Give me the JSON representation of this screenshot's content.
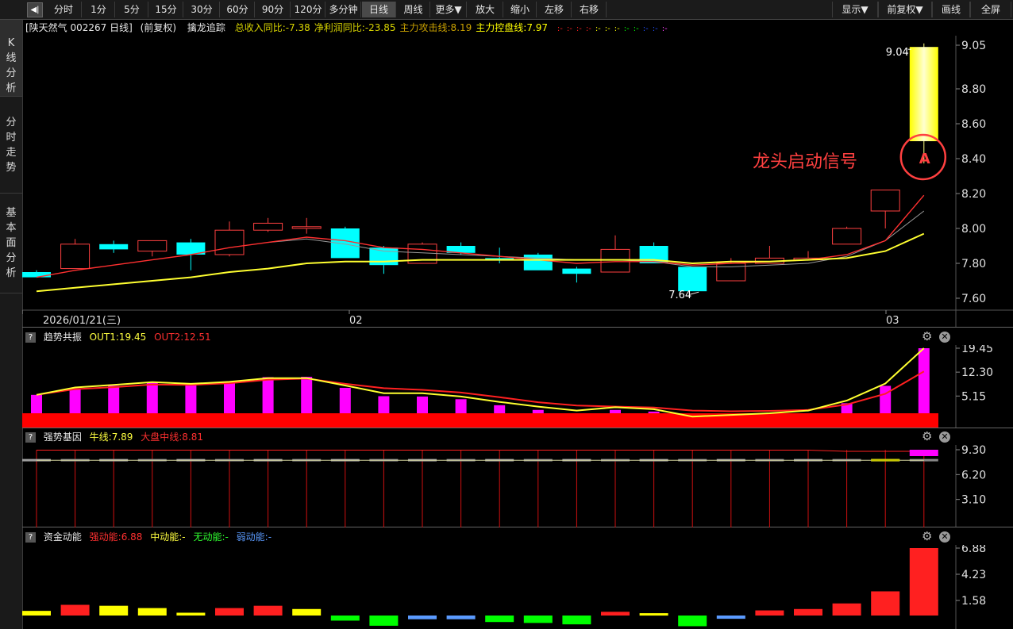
{
  "toolbar": {
    "items": [
      "分时",
      "1分",
      "5分",
      "15分",
      "30分",
      "60分",
      "90分",
      "120分",
      "多分钟",
      "日线",
      "周线",
      "更多▼",
      "放大",
      "缩小",
      "左移",
      "右移"
    ],
    "right": [
      "显示▼",
      "前复权▼",
      "画线",
      "全屏"
    ],
    "back_glyph": "◀|"
  },
  "leftnav": [
    "K线分析",
    "分时走势",
    "基本面分析"
  ],
  "main": {
    "stock": "[陕天然气 002267 日线]",
    "adjust": "(前复权)",
    "indicator": "擒龙追踪",
    "stats": [
      {
        "text": "总收入同比:-7.38",
        "color": "#d8d400"
      },
      {
        "text": "净利润同比:-23.85",
        "color": "#d8d400"
      },
      {
        "text": "主力攻击线:8.19",
        "color": "#c8a000"
      },
      {
        "text": "主力控盘线:7.97",
        "color": "#ffff00"
      }
    ],
    "dots": [
      "#ff2020",
      "#ff2020",
      "#ff2020",
      "#ff2020",
      "#ffff00",
      "#ffff00",
      "#ffff00",
      "#00ff00",
      "#00ff00",
      "#2050ff",
      "#2050ff",
      "#ff40ff"
    ],
    "dot_glyph": ":-",
    "price_ticks": [
      "9.05",
      "8.80",
      "8.60",
      "8.40",
      "8.20",
      "8.00",
      "7.80",
      "7.60"
    ],
    "date_labels": [
      "2026/01/21(三)",
      "02",
      "03"
    ],
    "max_label": "9.04",
    "min_label": "7.64",
    "signal_text": "龙头启动信号",
    "signal_glyph": "A"
  },
  "panel_trend": {
    "name": "趋势共振",
    "out1": "OUT1:19.45",
    "out2": "OUT2:12.51",
    "ticks": [
      "19.45",
      "12.30",
      "5.15"
    ]
  },
  "panel_gene": {
    "name": "强势基因",
    "bull": "牛线:7.89",
    "mid": "大盘中线:8.81",
    "ticks": [
      "9.30",
      "6.20",
      "3.10"
    ]
  },
  "panel_fund": {
    "name": "资金动能",
    "strong": "强动能:6.88",
    "medium": "中动能:-",
    "none": "无动能:-",
    "weak": "弱动能:-",
    "ticks": [
      "6.88",
      "4.23",
      "1.58"
    ]
  },
  "colors": {
    "up": "#ff4040",
    "down": "#00ffff",
    "ma_fast": "#ff3030",
    "ma_slow": "#ffff30",
    "ma_gray": "#9a9a9a",
    "magenta": "#ff00ff",
    "signal": "#ff4040"
  },
  "chart_data": {
    "type": "candlestick",
    "candles": [
      {
        "o": 7.75,
        "c": 7.72,
        "h": 7.76,
        "l": 7.72
      },
      {
        "o": 7.77,
        "c": 7.91,
        "h": 7.94,
        "l": 7.77
      },
      {
        "o": 7.91,
        "c": 7.88,
        "h": 7.93,
        "l": 7.86
      },
      {
        "o": 7.87,
        "c": 7.93,
        "h": 7.93,
        "l": 7.84
      },
      {
        "o": 7.92,
        "c": 7.85,
        "h": 7.94,
        "l": 7.76
      },
      {
        "o": 7.85,
        "c": 7.99,
        "h": 8.04,
        "l": 7.84
      },
      {
        "o": 7.99,
        "c": 8.03,
        "h": 8.06,
        "l": 7.98
      },
      {
        "o": 8.0,
        "c": 8.01,
        "h": 8.06,
        "l": 7.97
      },
      {
        "o": 8.0,
        "c": 7.83,
        "h": 8.01,
        "l": 7.83
      },
      {
        "o": 7.89,
        "c": 7.79,
        "h": 7.9,
        "l": 7.74
      },
      {
        "o": 7.8,
        "c": 7.91,
        "h": 7.92,
        "l": 7.8
      },
      {
        "o": 7.9,
        "c": 7.86,
        "h": 7.92,
        "l": 7.85
      },
      {
        "o": 7.83,
        "c": 7.82,
        "h": 7.89,
        "l": 7.8
      },
      {
        "o": 7.85,
        "c": 7.76,
        "h": 7.86,
        "l": 7.76
      },
      {
        "o": 7.77,
        "c": 7.74,
        "h": 7.78,
        "l": 7.69
      },
      {
        "o": 7.75,
        "c": 7.88,
        "h": 7.96,
        "l": 7.75
      },
      {
        "o": 7.9,
        "c": 7.8,
        "h": 7.92,
        "l": 7.8
      },
      {
        "o": 7.78,
        "c": 7.64,
        "h": 7.78,
        "l": 7.64
      },
      {
        "o": 7.7,
        "c": 7.8,
        "h": 7.83,
        "l": 7.7
      },
      {
        "o": 7.8,
        "c": 7.83,
        "h": 7.9,
        "l": 7.8
      },
      {
        "o": 7.82,
        "c": 7.83,
        "h": 7.87,
        "l": 7.82
      },
      {
        "o": 7.91,
        "c": 8.0,
        "h": 8.01,
        "l": 7.91
      },
      {
        "o": 8.1,
        "c": 8.22,
        "h": 8.22,
        "l": 8.0
      },
      {
        "o": 8.5,
        "c": 9.04,
        "h": 9.06,
        "l": 8.5
      }
    ],
    "ma_fast": [
      7.72,
      7.76,
      7.79,
      7.82,
      7.85,
      7.89,
      7.92,
      7.95,
      7.93,
      7.89,
      7.88,
      7.86,
      7.84,
      7.82,
      7.8,
      7.81,
      7.81,
      7.79,
      7.8,
      7.81,
      7.82,
      7.85,
      7.93,
      8.19
    ],
    "ma_slow": [
      7.64,
      7.66,
      7.68,
      7.7,
      7.72,
      7.75,
      7.77,
      7.8,
      7.81,
      7.81,
      7.82,
      7.82,
      7.82,
      7.82,
      7.82,
      7.82,
      7.82,
      7.8,
      7.81,
      7.81,
      7.82,
      7.83,
      7.87,
      7.97
    ],
    "ma_gray": [
      null,
      null,
      null,
      null,
      null,
      null,
      7.92,
      7.94,
      7.91,
      7.87,
      7.86,
      7.85,
      7.84,
      7.83,
      7.82,
      7.82,
      7.81,
      7.78,
      7.78,
      7.79,
      7.8,
      7.84,
      7.93,
      8.1
    ],
    "trend_bars": [
      5.5,
      7.4,
      8.2,
      9.3,
      8.7,
      9.4,
      10.8,
      10.9,
      7.6,
      5.1,
      5.0,
      4.2,
      2.4,
      1.0,
      0,
      1.0,
      0.5,
      0,
      0,
      0,
      0,
      3.0,
      8.2,
      19.45
    ],
    "trend_out1": [
      5.5,
      7.7,
      8.5,
      9.3,
      8.8,
      9.4,
      10.5,
      10.5,
      8.3,
      6.0,
      6.0,
      5.0,
      3.4,
      2.0,
      0.8,
      1.8,
      1.2,
      -1.0,
      -0.5,
      0,
      0.8,
      3.8,
      8.9,
      19.45
    ],
    "trend_out2": [
      5.5,
      7.2,
      7.8,
      8.6,
      8.5,
      9.0,
      10.0,
      10.4,
      8.8,
      7.5,
      7.0,
      6.2,
      4.8,
      3.3,
      2.3,
      2.0,
      1.7,
      0.8,
      0.6,
      0.7,
      1.0,
      2.6,
      5.8,
      12.51
    ],
    "trend_ylim": [
      0,
      19.45
    ],
    "fund_bars": [
      1.0,
      2.3,
      2.1,
      1.6,
      0.6,
      1.6,
      2.1,
      1.4,
      -1.1,
      -2.2,
      -0.8,
      -0.8,
      -1.4,
      -1.6,
      -1.9,
      0.8,
      0.5,
      -2.3,
      -0.7,
      1.1,
      1.4,
      2.6,
      5.2,
      14.5
    ],
    "fund_colors": [
      "#ffff00",
      "#ff2020",
      "#ffff00",
      "#ffff00",
      "#ffff00",
      "#ff2020",
      "#ff2020",
      "#ffff00",
      "#00ff00",
      "#00ff00",
      "#5b9bff",
      "#5b9bff",
      "#00ff00",
      "#00ff00",
      "#00ff00",
      "#ff2020",
      "#ffff00",
      "#00ff00",
      "#5b9bff",
      "#ff2020",
      "#ff2020",
      "#ff2020",
      "#ff2020",
      "#ff2020"
    ],
    "price_ylim": [
      7.55,
      9.1
    ]
  }
}
